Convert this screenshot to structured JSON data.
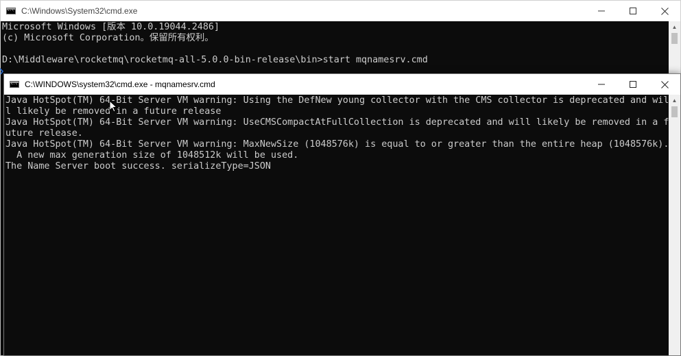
{
  "back_window": {
    "title": "C:\\Windows\\System32\\cmd.exe",
    "lines": [
      "Microsoft Windows [版本 10.0.19044.2486]",
      "(c) Microsoft Corporation。保留所有权利。",
      "",
      "D:\\Middleware\\rocketmq\\rocketmq-all-5.0.0-bin-release\\bin>start mqnamesrv.cmd"
    ]
  },
  "front_window": {
    "title": "C:\\WINDOWS\\system32\\cmd.exe - mqnamesrv.cmd",
    "lines": [
      "Java HotSpot(TM) 64-Bit Server VM warning: Using the DefNew young collector with the CMS collector is deprecated and wil",
      "l likely be removed in a future release",
      "Java HotSpot(TM) 64-Bit Server VM warning: UseCMSCompactAtFullCollection is deprecated and will likely be removed in a f",
      "uture release.",
      "Java HotSpot(TM) 64-Bit Server VM warning: MaxNewSize (1048576k) is equal to or greater than the entire heap (1048576k).",
      "  A new max generation size of 1048512k will be used.",
      "The Name Server boot success. serializeType=JSON"
    ]
  },
  "icons": {
    "minimize": "minimize-icon",
    "maximize": "maximize-icon",
    "close": "close-icon",
    "app": "cmd-icon",
    "cursor": "mouse-cursor-icon"
  },
  "colors": {
    "console_bg": "#0c0c0c",
    "console_fg": "#cccccc",
    "titlebar_bg": "#ffffff",
    "scrollbar_bg": "#f0f0f0"
  }
}
